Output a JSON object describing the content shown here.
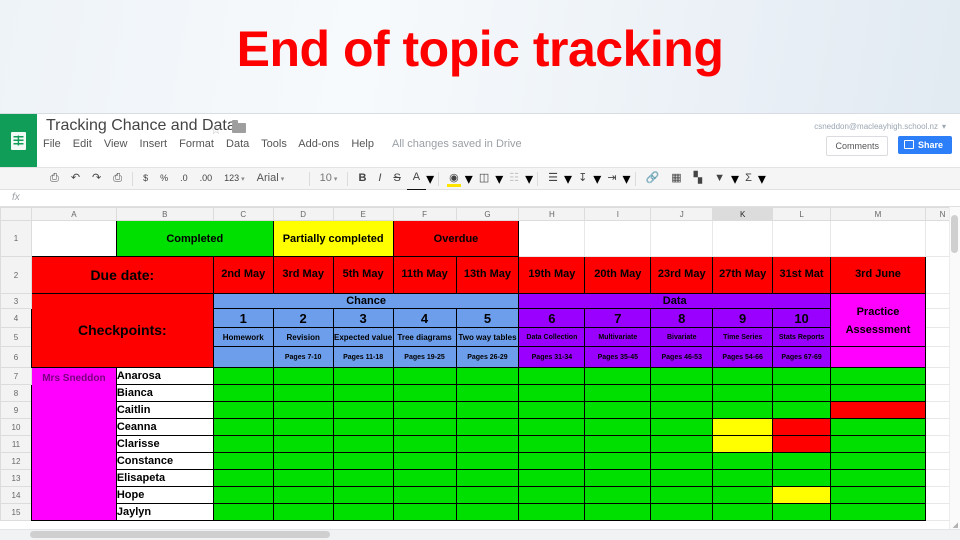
{
  "slide": {
    "title": "End of topic tracking"
  },
  "app": {
    "logo_icon": "sheets-logo-icon",
    "doc_title": "Tracking Chance and Data",
    "star_icon": "star-icon",
    "folder_icon": "folder-icon",
    "menus": [
      "File",
      "Edit",
      "View",
      "Insert",
      "Format",
      "Data",
      "Tools",
      "Add-ons",
      "Help"
    ],
    "save_state": "All changes saved in Drive",
    "account_email": "csneddon@macleayhigh.school.nz",
    "account_caret": "▾",
    "comments_label": "Comments",
    "share_label": "Share",
    "share_lock_icon": "lock-icon"
  },
  "toolbar": {
    "items": [
      {
        "name": "print-icon",
        "glyph": "⎙"
      },
      {
        "name": "undo-icon",
        "glyph": "↶"
      },
      {
        "name": "redo-icon",
        "glyph": "↷"
      },
      {
        "name": "paint-format-icon",
        "glyph": "⎙"
      },
      {
        "name": "currency-icon",
        "glyph": "$"
      },
      {
        "name": "percent-icon",
        "glyph": "%"
      },
      {
        "name": "decrease-decimal-icon",
        "glyph": ".0"
      },
      {
        "name": "increase-decimal-icon",
        "glyph": ".00"
      },
      {
        "name": "number-format-icon",
        "glyph": "123"
      }
    ],
    "font_name": "Arial",
    "font_size": "10",
    "bold": "B",
    "italic": "I",
    "strikethrough": "S",
    "text_color": "A",
    "fill_color_icon": "fill-color-icon",
    "borders_icon": "borders-icon",
    "merge_icon": "merge-cells-icon",
    "align_icon": "horizontal-align-icon",
    "valign_icon": "vertical-align-icon",
    "wrap_icon": "text-wrap-icon",
    "link_icon": "insert-link-icon",
    "comment_icon": "insert-comment-icon",
    "chart_icon": "insert-chart-icon",
    "filter_icon": "filter-icon",
    "functions_icon": "functions-icon",
    "dropdown_caret": "▾"
  },
  "formula_bar": {
    "fx_label": "fx",
    "value": ""
  },
  "sheet": {
    "column_headers": [
      "A",
      "B",
      "C",
      "D",
      "E",
      "F",
      "G",
      "H",
      "I",
      "J",
      "K",
      "L",
      "M",
      "N"
    ],
    "selected_column": "K",
    "row_headers": [
      "1",
      "2",
      "3",
      "4",
      "5",
      "6",
      "7",
      "8",
      "9",
      "10",
      "11",
      "12",
      "13",
      "14",
      "15"
    ],
    "legend": [
      {
        "label": "",
        "color": "#ffffff"
      },
      {
        "label": "Completed",
        "color": "#00e000"
      },
      {
        "label": "Partially completed",
        "color": "#ffff00"
      },
      {
        "label": "Overdue",
        "color": "#fe0000"
      }
    ],
    "due_date_label": "Due date:",
    "due_dates": [
      "2nd May",
      "3rd May",
      "5th May",
      "11th May",
      "13th May",
      "19th May",
      "20th May",
      "23rd May",
      "27th May",
      "31st Mat",
      "3rd June"
    ],
    "checkpoints_label": "Checkpoints:",
    "sections": [
      {
        "label": "Chance",
        "color": "#6d9eeb"
      },
      {
        "label": "Data",
        "color": "#9900ff"
      },
      {
        "label": "Practice Assessment",
        "color": "#ff00ff"
      }
    ],
    "checkpoint_numbers": [
      "1",
      "2",
      "3",
      "4",
      "5",
      "6",
      "7",
      "8",
      "9",
      "10"
    ],
    "checkpoint_topics": [
      "Homework",
      "Revision",
      "Expected value",
      "Tree diagrams",
      "Two way tables",
      "Data Collection",
      "Multivariate",
      "Bivariate",
      "Time Series",
      "Stats Reports"
    ],
    "checkpoint_pages": [
      "",
      "Pages 7-10",
      "Pages 11-18",
      "Pages 19-25",
      "Pages 26-29",
      "Pages 31-34",
      "Pages 35-45",
      "Pages 46-53",
      "Pages 54-66",
      "Pages 67-69"
    ],
    "teacher_label": "Mrs Sneddon",
    "students": [
      "Anarosa",
      "Bianca",
      "Caitlin",
      "Ceanna",
      "Clarisse",
      "Constance",
      "Elisapeta",
      "Hope",
      "Jaylyn"
    ],
    "status_colors": {
      "completed": "#00e000",
      "partial": "#ffff00",
      "overdue": "#fe0000"
    },
    "status_grid": [
      [
        "completed",
        "completed",
        "completed",
        "completed",
        "completed",
        "completed",
        "completed",
        "completed",
        "completed",
        "completed",
        "completed"
      ],
      [
        "completed",
        "completed",
        "completed",
        "completed",
        "completed",
        "completed",
        "completed",
        "completed",
        "completed",
        "completed",
        "completed"
      ],
      [
        "completed",
        "completed",
        "completed",
        "completed",
        "completed",
        "completed",
        "completed",
        "completed",
        "completed",
        "completed",
        "overdue"
      ],
      [
        "completed",
        "completed",
        "completed",
        "completed",
        "completed",
        "completed",
        "completed",
        "completed",
        "partial",
        "overdue",
        "completed"
      ],
      [
        "completed",
        "completed",
        "completed",
        "completed",
        "completed",
        "completed",
        "completed",
        "completed",
        "partial",
        "overdue",
        "completed"
      ],
      [
        "completed",
        "completed",
        "completed",
        "completed",
        "completed",
        "completed",
        "completed",
        "completed",
        "completed",
        "completed",
        "completed"
      ],
      [
        "completed",
        "completed",
        "completed",
        "completed",
        "completed",
        "completed",
        "completed",
        "completed",
        "completed",
        "completed",
        "completed"
      ],
      [
        "completed",
        "completed",
        "completed",
        "completed",
        "completed",
        "completed",
        "completed",
        "completed",
        "completed",
        "partial",
        "completed"
      ],
      [
        "completed",
        "completed",
        "completed",
        "completed",
        "completed",
        "completed",
        "completed",
        "completed",
        "completed",
        "completed",
        "completed"
      ]
    ]
  }
}
